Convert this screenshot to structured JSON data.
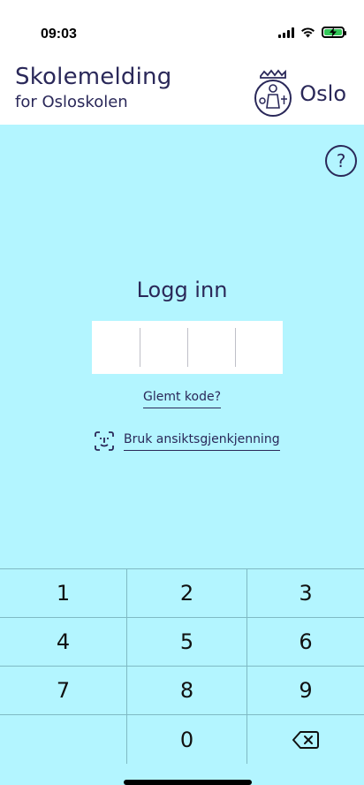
{
  "status_bar": {
    "time": "09:03"
  },
  "header": {
    "title": "Skolemelding",
    "subtitle": "for Osloskolen",
    "logo_text": "Oslo"
  },
  "help": {
    "label": "?"
  },
  "login": {
    "title": "Logg inn",
    "forgot_code": "Glemt kode?",
    "face_id_label": "Bruk ansiktsgjenkjenning"
  },
  "keypad": {
    "keys": [
      "1",
      "2",
      "3",
      "4",
      "5",
      "6",
      "7",
      "8",
      "9",
      "",
      "0",
      "backspace"
    ]
  },
  "colors": {
    "background": "#b3f5ff",
    "text": "#2a2859",
    "header_bg": "#ffffff",
    "battery": "#34c759"
  },
  "icons": {
    "wifi": "wifi-icon",
    "signal": "signal-icon",
    "battery": "battery-charging-icon",
    "face_id": "face-id-icon",
    "backspace": "backspace-icon",
    "oslo_logo": "oslo-crest-icon"
  }
}
